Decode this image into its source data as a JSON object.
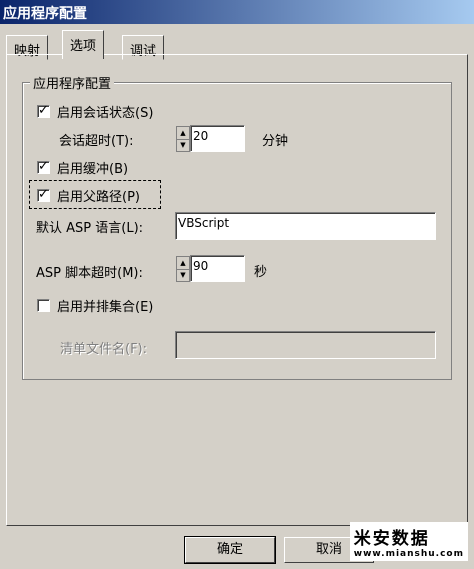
{
  "window": {
    "title": "应用程序配置"
  },
  "tabs": [
    {
      "label": "映射",
      "active": false
    },
    {
      "label": "选项",
      "active": true
    },
    {
      "label": "调试",
      "active": false
    }
  ],
  "group": {
    "label": "应用程序配置"
  },
  "options": {
    "session_state": {
      "label": "启用会话状态(S)",
      "checked": true
    },
    "session_timeout": {
      "label": "会话超时(T):",
      "value": "20",
      "unit": "分钟"
    },
    "buffering": {
      "label": "启用缓冲(B)",
      "checked": true
    },
    "parent_paths": {
      "label": "启用父路径(P)",
      "checked": true
    },
    "default_language": {
      "label": "默认 ASP 语言(L):",
      "value": "VBScript"
    },
    "script_timeout": {
      "label": "ASP 脚本超时(M):",
      "value": "90",
      "unit": "秒"
    },
    "side_by_side": {
      "label": "启用并排集合(E)",
      "checked": false
    },
    "manifest": {
      "label": "清单文件名(F):",
      "value": ""
    }
  },
  "buttons": {
    "ok": "确定",
    "cancel": "取消"
  },
  "watermark": {
    "text": "米安数据",
    "url": "www.mianshu.com"
  },
  "colors": {
    "face": "#d4d0c8",
    "title_start": "#0a246a",
    "title_end": "#a6caf0"
  }
}
